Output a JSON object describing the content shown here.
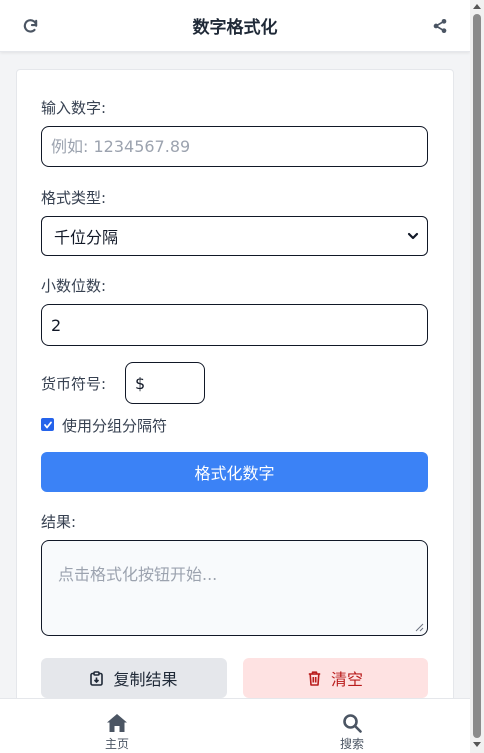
{
  "header": {
    "title": "数字格式化",
    "refresh_icon": "refresh-icon",
    "share_icon": "share-icon"
  },
  "form": {
    "number_label": "输入数字:",
    "number_placeholder": "例如: 1234567.89",
    "number_value": "",
    "format_label": "格式类型:",
    "format_selected": "千位分隔",
    "decimals_label": "小数位数:",
    "decimals_value": "2",
    "currency_label": "货币符号:",
    "currency_value": "$",
    "grouping_checked": true,
    "grouping_label": "使用分组分隔符",
    "format_button": "格式化数字",
    "result_label": "结果:",
    "result_placeholder": "点击格式化按钮开始...",
    "copy_button": "复制结果",
    "clear_button": "清空"
  },
  "nav": {
    "home_label": "主页",
    "search_label": "搜索"
  },
  "colors": {
    "primary": "#3b82f6",
    "clear_bg": "#fee2e2",
    "clear_text": "#b91c1c",
    "copy_bg": "#e5e7eb"
  }
}
